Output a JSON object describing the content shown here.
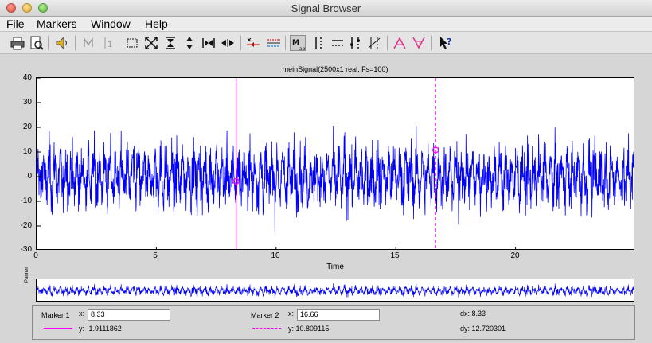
{
  "window": {
    "title": "Signal Browser"
  },
  "menu": [
    "File",
    "Markers",
    "Window",
    "Help"
  ],
  "toolbar": {
    "buttons": [
      "print-icon",
      "print-preview-icon",
      "play-audio-icon",
      "snap-to-data-icon",
      "insert-marker-icon",
      "zoom-box-icon",
      "fit-to-view-icon",
      "zoom-y-icon",
      "zoom-y-alt-icon",
      "zoom-x-in-icon",
      "zoom-x-out-icon",
      "display-mode-icon",
      "line-display-icon",
      "marker-readout-icon",
      "vertical-markers-icon",
      "horizontal-markers-icon",
      "track-markers-icon",
      "slope-markers-icon",
      "peaks-icon",
      "valleys-icon",
      "whats-this-icon"
    ],
    "pressed": "marker-readout-icon"
  },
  "plot": {
    "title": "meinSignal(2500x1 real, Fs=100)",
    "xlabel": "Time",
    "yticks": [
      "40",
      "30",
      "20",
      "10",
      "0",
      "-10",
      "-20",
      "-30"
    ],
    "xticks": [
      "0",
      "5",
      "10",
      "15",
      "20"
    ]
  },
  "panner": {
    "label": "Panner"
  },
  "markers": {
    "marker1": {
      "label": "Marker 1",
      "x_label": "x:",
      "x": "8.33",
      "y": "y: -1.9111862"
    },
    "marker2": {
      "label": "Marker 2",
      "x_label": "x:",
      "x": "16.66",
      "y": "y: 10.809115"
    },
    "dx": "dx: 8.33",
    "dy": "dy: 12.720301"
  },
  "chart_data": {
    "type": "line",
    "title": "meinSignal(2500x1 real, Fs=100)",
    "xlabel": "Time",
    "ylabel": "",
    "xlim": [
      0,
      25
    ],
    "ylim": [
      -30,
      40
    ],
    "x_ticks": [
      0,
      5,
      10,
      15,
      20
    ],
    "y_ticks": [
      -30,
      -20,
      -10,
      0,
      10,
      20,
      30,
      40
    ],
    "series": [
      {
        "color": "#0000ff",
        "samples": 2500,
        "fs": 100,
        "approx_range": [
          -25,
          33
        ]
      }
    ],
    "markers": [
      {
        "x": 8.33,
        "y": -1.9111862,
        "style": "solid",
        "color": "#ff00ff"
      },
      {
        "x": 16.66,
        "y": 10.809115,
        "style": "dashed",
        "color": "#ff00ff"
      }
    ],
    "grid": false
  },
  "colors": {
    "signal": "#0000ff",
    "marker": "#ff00ff"
  }
}
